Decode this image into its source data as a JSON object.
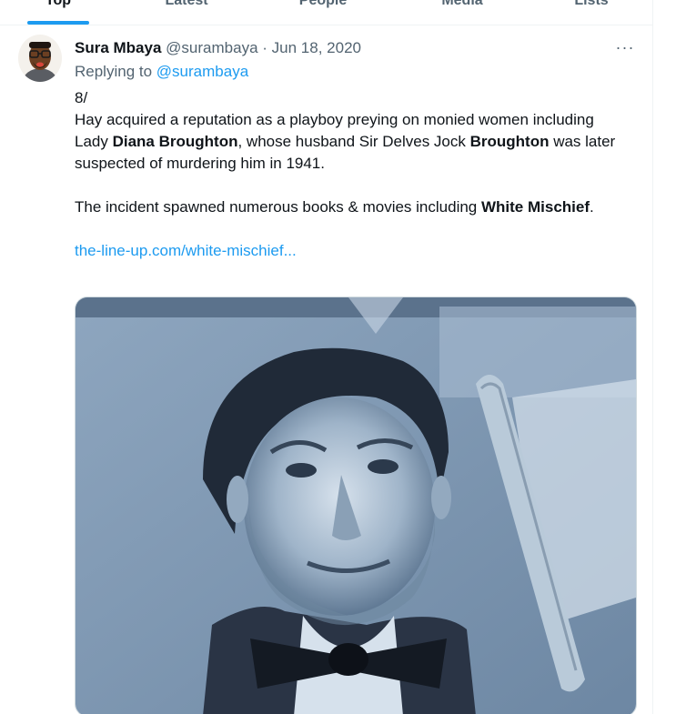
{
  "tabs": [
    "Top",
    "Latest",
    "People",
    "Media",
    "Lists"
  ],
  "tweet": {
    "display_name": "Sura Mbaya",
    "handle": "@surambaya",
    "separator": "·",
    "date": "Jun 18, 2020",
    "more_label": "···",
    "replying_prefix": "Replying to",
    "replying_to": "@surambaya",
    "thread_number": "8/",
    "p1_a": "Hay acquired a reputation as a playboy preying on monied women including Lady ",
    "p1_b": "Diana Broughton",
    "p1_c": ", whose husband Sir Delves Jock ",
    "p1_d": "Broughton",
    "p1_e": " was later suspected of murdering him in 1941.",
    "p2_a": "The incident spawned numerous books & movies including ",
    "p2_b": "White Mischief",
    "p2_c": ".",
    "link": "the-line-up.com/white-mischief..."
  },
  "colors": {
    "accent": "#1d9bf0",
    "text": "#0f1419",
    "muted": "#536471",
    "photo_tint": "#7f9bb8"
  },
  "icons": {
    "more": "more-horizontal-icon",
    "avatar": "cartoon-avatar-icon"
  }
}
